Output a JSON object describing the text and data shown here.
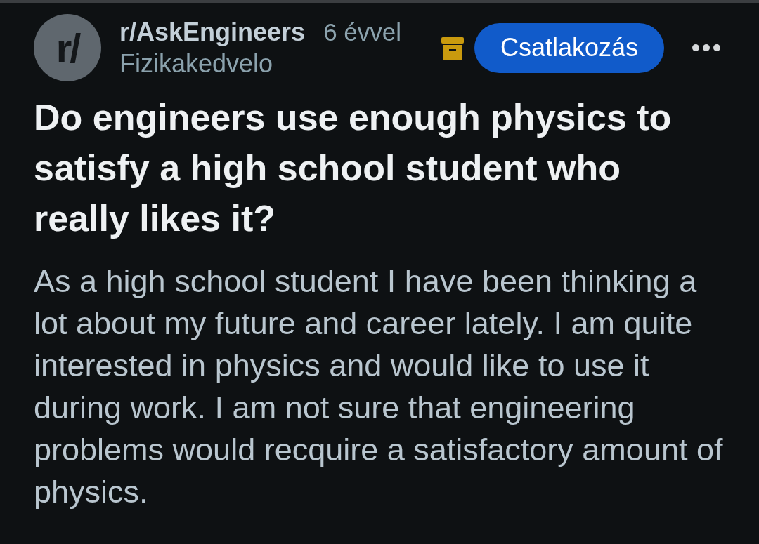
{
  "post": {
    "avatar_text": "r/",
    "subreddit": "r/AskEngineers",
    "age": "6 évvel",
    "author": "Fizikakedvelo",
    "archived": true,
    "join_button": "Csatlakozás",
    "title": "Do engineers use enough physics to satisfy a high school student who really likes it?",
    "body": "As a high school student I have been thinking a lot about my future and career lately. I am quite interested in physics and would like to use it during work. I am not sure that engineering problems would recquire a satisfactory amount of physics."
  }
}
